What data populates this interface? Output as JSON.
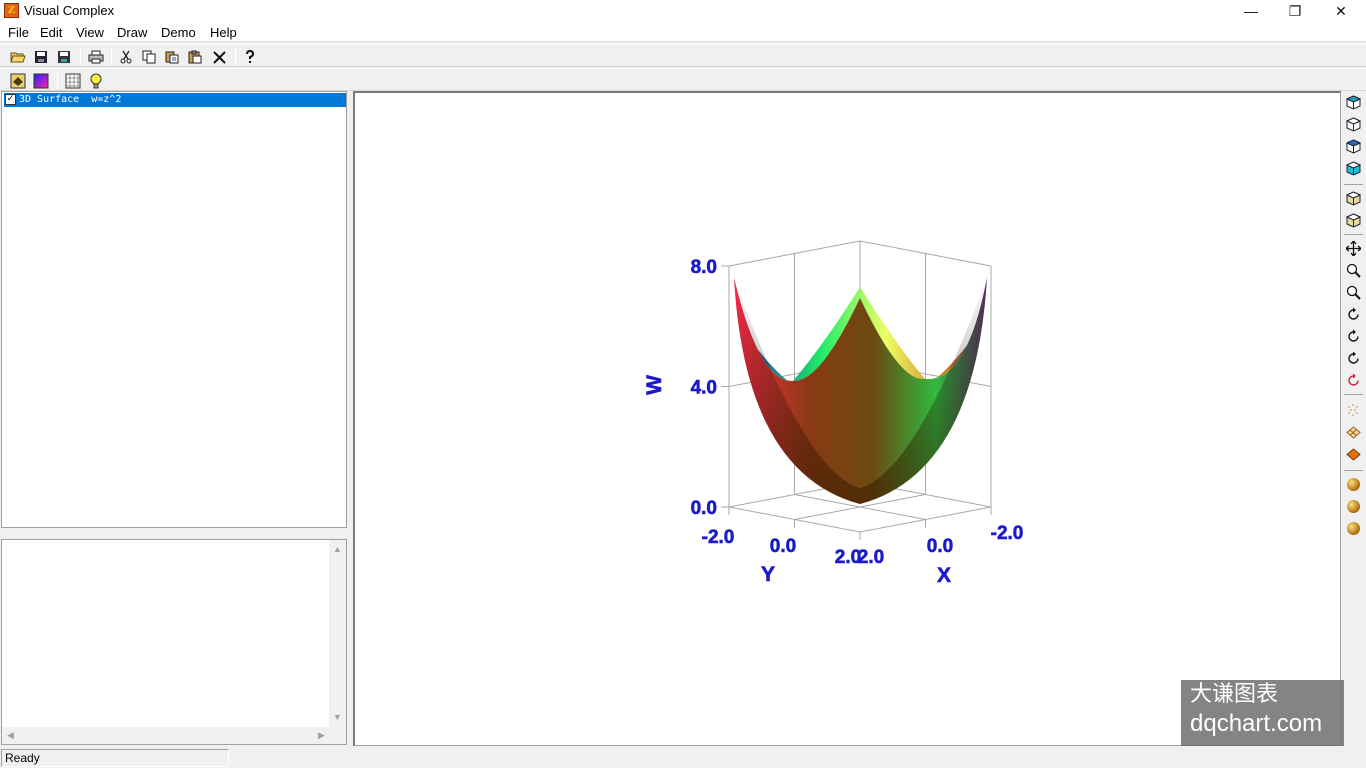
{
  "window": {
    "title": "Visual Complex",
    "app_icon_letter": "Z",
    "minimize_glyph": "—",
    "maximize_glyph": "❐",
    "close_glyph": "✕"
  },
  "menu": [
    "File",
    "Edit",
    "View",
    "Draw",
    "Demo",
    "Help"
  ],
  "toolbar1": [
    {
      "name": "open-icon",
      "glyph": "📂"
    },
    {
      "name": "save-icon",
      "glyph": "💾"
    },
    {
      "name": "save-all-icon",
      "glyph": "💾"
    },
    {
      "name": "print-icon",
      "glyph": "🖨"
    },
    {
      "name": "cut-icon",
      "glyph": "✂"
    },
    {
      "name": "copy-icon",
      "glyph": "❐"
    },
    {
      "name": "paste-special-icon",
      "glyph": "⎘"
    },
    {
      "name": "paste-icon",
      "glyph": "📋"
    },
    {
      "name": "delete-icon",
      "glyph": "✕"
    },
    {
      "name": "help-icon",
      "glyph": "?"
    }
  ],
  "toolbar2": [
    {
      "name": "surface-style-icon",
      "glyph": "◆"
    },
    {
      "name": "color-map-icon",
      "glyph": "■"
    },
    {
      "name": "grid-icon",
      "glyph": "▦"
    },
    {
      "name": "light-bulb-icon",
      "glyph": "💡"
    }
  ],
  "tree": {
    "items": [
      {
        "label": "3D Surface  w=z^2",
        "checked": true,
        "check_glyph": "✓"
      }
    ]
  },
  "info_panel": {
    "up_arrow": "▲",
    "down_arrow": "▼",
    "left_arrow": "◀",
    "right_arrow": "▶"
  },
  "status": {
    "text": "Ready"
  },
  "watermark": {
    "line1": "大谦图表",
    "line2": "dqchart.com"
  },
  "colors": {
    "axis_text": "#1a1acd",
    "frame_gray": "#a8a8a8",
    "selection": "#0078d7"
  },
  "right_toolbar": [
    "view-front-icon",
    "view-side-icon",
    "view-top-icon",
    "view-iso-icon",
    "box-icon",
    "base-icon",
    "pan-icon",
    "zoom-in-icon",
    "zoom-out-icon",
    "rotate-icon",
    "rotate-x-icon",
    "rotate-y-icon",
    "rotate-z-icon",
    "points-icon",
    "mesh-icon",
    "surface-icon",
    "sphere-icon",
    "sphere-icon",
    "sphere-icon"
  ],
  "chart_data": {
    "type": "surface",
    "function": "w=z^2",
    "x_axis": {
      "label": "X",
      "ticks": [
        "-2.0",
        "0.0",
        "2.0"
      ],
      "range": [
        -2,
        2
      ]
    },
    "y_axis": {
      "label": "Y",
      "ticks": [
        "-2.0",
        "0.0",
        "2.0"
      ],
      "range": [
        -2,
        2
      ]
    },
    "w_axis": {
      "label": "W",
      "ticks": [
        "0.0",
        "4.0",
        "8.0"
      ],
      "range": [
        0,
        8
      ]
    },
    "colormap": [
      "#ff2a4a",
      "#7a3c10",
      "#22ee55",
      "#eeff66",
      "#3a1aaa"
    ]
  }
}
